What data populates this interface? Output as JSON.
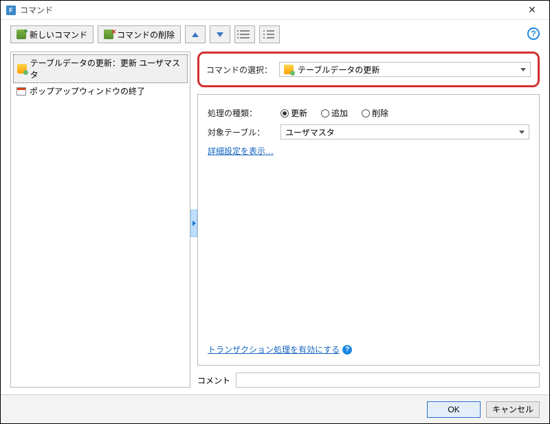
{
  "window": {
    "title": "コマンド"
  },
  "toolbar": {
    "new_command": "新しいコマンド",
    "delete_command": "コマンドの削除"
  },
  "tree": {
    "items": [
      {
        "label": "テーブルデータの更新：更新 ユーザマスタ",
        "selected": true
      },
      {
        "label": "ポップアップウィンドウの終了",
        "selected": false
      }
    ]
  },
  "command_select": {
    "label": "コマンドの選択：",
    "value": "テーブルデータの更新"
  },
  "process": {
    "label": "処理の種類：",
    "options": {
      "update": "更新",
      "add": "追加",
      "delete": "削除"
    },
    "selected": "update"
  },
  "target_table": {
    "label": "対象テーブル：",
    "value": "ユーザマスタ"
  },
  "links": {
    "detail": "詳細設定を表示…",
    "transaction": "トランザクション処理を有効にする"
  },
  "comment": {
    "label": "コメント",
    "value": ""
  },
  "footer": {
    "ok": "OK",
    "cancel": "キャンセル"
  }
}
